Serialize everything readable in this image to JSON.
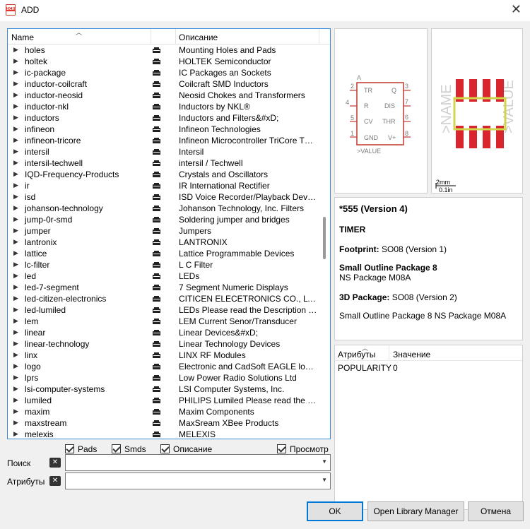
{
  "window": {
    "title": "ADD",
    "icon_text": "SCH"
  },
  "list": {
    "columns": {
      "name": "Name",
      "description": "Описание"
    },
    "rows": [
      {
        "name": "holes",
        "desc": "Mounting Holes and Pads"
      },
      {
        "name": "holtek",
        "desc": "HOLTEK Semiconductor"
      },
      {
        "name": "ic-package",
        "desc": "IC Packages an Sockets"
      },
      {
        "name": "inductor-coilcraft",
        "desc": "Coilcraft SMD Inductors"
      },
      {
        "name": "inductor-neosid",
        "desc": "Neosid Chokes and Transformers"
      },
      {
        "name": "inductor-nkl",
        "desc": "Inductors by NKL®"
      },
      {
        "name": "inductors",
        "desc": "Inductors and Filters&#xD;"
      },
      {
        "name": "infineon",
        "desc": "Infineon Technologies"
      },
      {
        "name": "infineon-tricore",
        "desc": "Infineon Microcontroller TriCore T…"
      },
      {
        "name": "intersil",
        "desc": "Intersil"
      },
      {
        "name": "intersil-techwell",
        "desc": "intersil / Techwell"
      },
      {
        "name": "IQD-Frequency-Products",
        "desc": "Crystals and Oscillators"
      },
      {
        "name": "ir",
        "desc": "IR International Rectifier"
      },
      {
        "name": "isd",
        "desc": "ISD Voice Recorder/Playback Devi…"
      },
      {
        "name": "johanson-technology",
        "desc": "Johanson Technology, Inc. Filters"
      },
      {
        "name": "jump-0r-smd",
        "desc": "Soldering jumper and bridges"
      },
      {
        "name": "jumper",
        "desc": "Jumpers"
      },
      {
        "name": "lantronix",
        "desc": "LANTRONIX"
      },
      {
        "name": "lattice",
        "desc": "Lattice Programmable Devices"
      },
      {
        "name": "lc-filter",
        "desc": "L C Filter"
      },
      {
        "name": "led",
        "desc": "LEDs"
      },
      {
        "name": "led-7-segment",
        "desc": "7 Segment Numeric Displays"
      },
      {
        "name": "led-citizen-electronics",
        "desc": "CITICEN ELECETRONICS CO., LTD."
      },
      {
        "name": "led-lumiled",
        "desc": "LEDs Please read the Description …"
      },
      {
        "name": "lem",
        "desc": "LEM Current Senor/Transducer"
      },
      {
        "name": "linear",
        "desc": "Linear Devices&#xD;"
      },
      {
        "name": "linear-technology",
        "desc": "Linear Technology Devices"
      },
      {
        "name": "linx",
        "desc": "LINX RF Modules"
      },
      {
        "name": "logo",
        "desc": "Electronic and CadSoft EAGLE log…"
      },
      {
        "name": "lprs",
        "desc": "Low Power Radio Solutions Ltd"
      },
      {
        "name": "lsi-computer-systems",
        "desc": "LSI Computer Systems, Inc."
      },
      {
        "name": "lumiled",
        "desc": "PHILIPS Lumiled Please read the …"
      },
      {
        "name": "maxim",
        "desc": "Maxim Components"
      },
      {
        "name": "maxstream",
        "desc": "MaxSream XBee Products"
      },
      {
        "name": "melexis",
        "desc": "MELEXIS"
      }
    ]
  },
  "filters": {
    "pads": "Pads",
    "smds": "Smds",
    "description": "Описание",
    "preview": "Просмотр"
  },
  "search": {
    "label": "Поиск",
    "value": ""
  },
  "attributes_filter": {
    "label": "Атрибуты",
    "value": ""
  },
  "symbol": {
    "name_label": "A",
    "value_label": ">VALUE",
    "pins_left": [
      {
        "num": "2",
        "name": "TR"
      },
      {
        "num": "4",
        "name": "R"
      },
      {
        "num": "5",
        "name": "CV"
      },
      {
        "num": "1",
        "name": "GND"
      }
    ],
    "pins_right": [
      {
        "num": "3",
        "name": "Q"
      },
      {
        "num": "7",
        "name": "DIS"
      },
      {
        "num": "6",
        "name": "THR"
      },
      {
        "num": "8",
        "name": "V+"
      }
    ]
  },
  "footprint_preview": {
    "name_text": ">NAME",
    "value_text": ">VALUE",
    "scale_mm": "2mm",
    "scale_in": "0.1in"
  },
  "details": {
    "title": "*555 (Version 4)",
    "subtitle": "TIMER",
    "footprint_label": "Footprint:",
    "footprint_value": "SO08 (Version 1)",
    "package_title": "Small Outline Package 8",
    "package_desc": "NS Package M08A",
    "package3d_label": "3D Package:",
    "package3d_value": "SO08 (Version 2)",
    "package3d_desc": "Small Outline Package 8 NS Package M08A"
  },
  "attributes_table": {
    "columns": {
      "attr": "Атрибуты",
      "value": "Значение"
    },
    "rows": [
      {
        "attr": "POPULARITY",
        "value": "0"
      }
    ]
  },
  "buttons": {
    "ok": "OK",
    "library_manager": "Open Library Manager",
    "cancel": "Отмена"
  },
  "colors": {
    "accent": "#0078d7",
    "pad_red": "#d9262e",
    "outline_yellow": "#cfd64a",
    "symbol_red": "#c0392b"
  }
}
